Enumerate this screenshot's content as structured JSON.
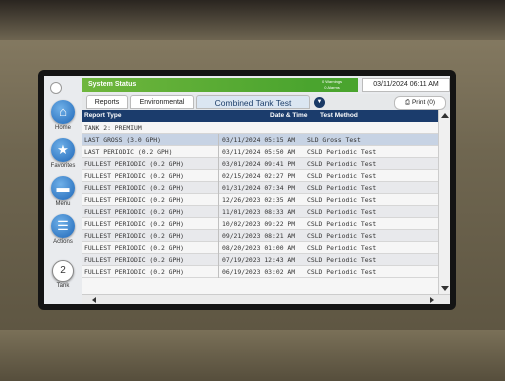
{
  "nav": {
    "home": "Home",
    "favorites": "Favorites",
    "menu": "Menu",
    "actions": "Actions",
    "tank_number": "2",
    "tank": "Tank"
  },
  "header": {
    "system_status": "System Status",
    "alarm_line1": "0 Warnings",
    "alarm_line2": "0 Alarms",
    "datetime": "03/11/2024 06:11 AM"
  },
  "tabs": {
    "reports": "Reports",
    "environmental": "Environmental",
    "combined": "Combined Tank Test",
    "print": "Print (0)"
  },
  "table": {
    "columns": [
      "Report Type",
      "Date & Time",
      "Test Method"
    ],
    "group_label": "TANK 2: PREMIUM",
    "rows": [
      {
        "type": "LAST GROSS (3.0 GPH)",
        "datetime": "03/11/2024 05:15 AM",
        "method": "SLD Gross Test"
      },
      {
        "type": "LAST PERIODIC (0.2 GPH)",
        "datetime": "03/11/2024 05:50 AM",
        "method": "CSLD Periodic Test"
      },
      {
        "type": "FULLEST PERIODIC (0.2 GPH)",
        "datetime": "03/01/2024 09:41 PM",
        "method": "CSLD Periodic Test"
      },
      {
        "type": "FULLEST PERIODIC (0.2 GPH)",
        "datetime": "02/15/2024 02:27 PM",
        "method": "CSLD Periodic Test"
      },
      {
        "type": "FULLEST PERIODIC (0.2 GPH)",
        "datetime": "01/31/2024 07:34 PM",
        "method": "CSLD Periodic Test"
      },
      {
        "type": "FULLEST PERIODIC (0.2 GPH)",
        "datetime": "12/26/2023 02:35 AM",
        "method": "CSLD Periodic Test"
      },
      {
        "type": "FULLEST PERIODIC (0.2 GPH)",
        "datetime": "11/01/2023 08:33 AM",
        "method": "CSLD Periodic Test"
      },
      {
        "type": "FULLEST PERIODIC (0.2 GPH)",
        "datetime": "10/02/2023 09:22 PM",
        "method": "CSLD Periodic Test"
      },
      {
        "type": "FULLEST PERIODIC (0.2 GPH)",
        "datetime": "09/21/2023 08:21 AM",
        "method": "CSLD Periodic Test"
      },
      {
        "type": "FULLEST PERIODIC (0.2 GPH)",
        "datetime": "08/20/2023 01:00 AM",
        "method": "CSLD Periodic Test"
      },
      {
        "type": "FULLEST PERIODIC (0.2 GPH)",
        "datetime": "07/19/2023 12:43 AM",
        "method": "CSLD Periodic Test"
      },
      {
        "type": "FULLEST PERIODIC (0.2 GPH)",
        "datetime": "06/19/2023 03:02 AM",
        "method": "CSLD Periodic Test"
      }
    ]
  }
}
